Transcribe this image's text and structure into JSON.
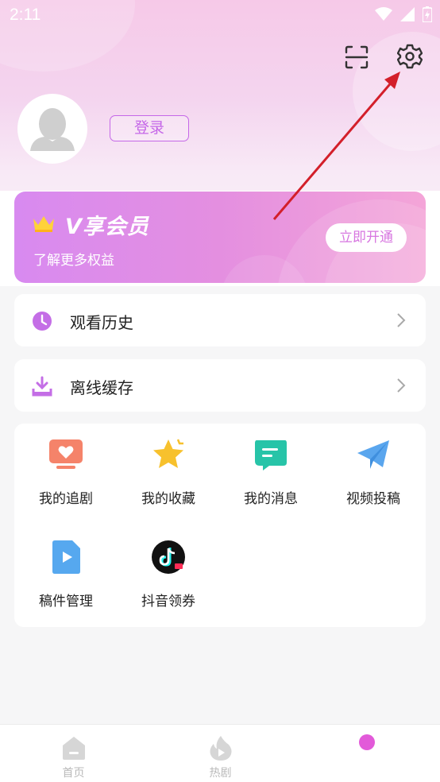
{
  "status_bar": {
    "time": "2:11"
  },
  "profile": {
    "login_label": "登录"
  },
  "vip": {
    "title": "V享会员",
    "subtitle": "了解更多权益",
    "cta_label": "立即开通"
  },
  "list": [
    {
      "label": "观看历史",
      "icon": "clock-icon"
    },
    {
      "label": "离线缓存",
      "icon": "download-icon"
    }
  ],
  "grid": [
    {
      "label": "我的追剧",
      "icon": "tv-heart-icon",
      "color": "#f5836a"
    },
    {
      "label": "我的收藏",
      "icon": "star-icon",
      "color": "#f7c12d"
    },
    {
      "label": "我的消息",
      "icon": "message-icon",
      "color": "#27c4a8"
    },
    {
      "label": "视频投稿",
      "icon": "paper-plane-icon",
      "color": "#5aa6ee"
    },
    {
      "label": "稿件管理",
      "icon": "video-file-icon",
      "color": "#56a8ef"
    },
    {
      "label": "抖音领券",
      "icon": "douyin-icon",
      "color": "#111111"
    }
  ],
  "tabs": [
    {
      "label": "首页",
      "icon": "home-icon"
    },
    {
      "label": "热剧",
      "icon": "flame-icon"
    },
    {
      "label": "",
      "icon": "profile-dot"
    }
  ],
  "colors": {
    "accent": "#c567e8",
    "vip_gradient_start": "#d88af0",
    "vip_gradient_end": "#f4a5d8",
    "annotation_arrow": "#d31f2a"
  }
}
